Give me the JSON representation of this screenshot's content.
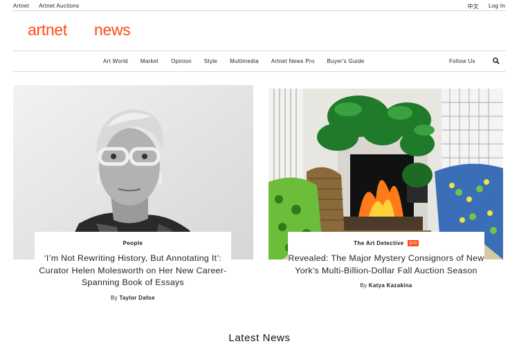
{
  "topbar": {
    "links": [
      "Artnet",
      "Artnet Auctions"
    ],
    "lang": "中文",
    "login": "Log In"
  },
  "logo": {
    "part1": "artnet",
    "part2": "news",
    "color": "#ff4b12"
  },
  "nav": {
    "items": [
      "Art World",
      "Market",
      "Opinion",
      "Style",
      "Multimedia",
      "Artnet News Pro",
      "Buyer's Guide"
    ],
    "follow": "Follow Us",
    "search_icon": "search-icon"
  },
  "articles": [
    {
      "category": "People",
      "pro": "",
      "title": "‘I’m Not Rewriting History, But Annotating It’: Curator Helen Molesworth on Her New Career-Spanning Book of Essays",
      "by": "By",
      "author": "Taylor Dafoe"
    },
    {
      "category": "The Art Detective",
      "pro": "pro",
      "title": "Revealed: The Major Mystery Consignors of New York’s Multi-Billion-Dollar Fall Auction Season",
      "by": "By",
      "author": "Katya Kazakina"
    }
  ],
  "latest_news": "Latest News"
}
